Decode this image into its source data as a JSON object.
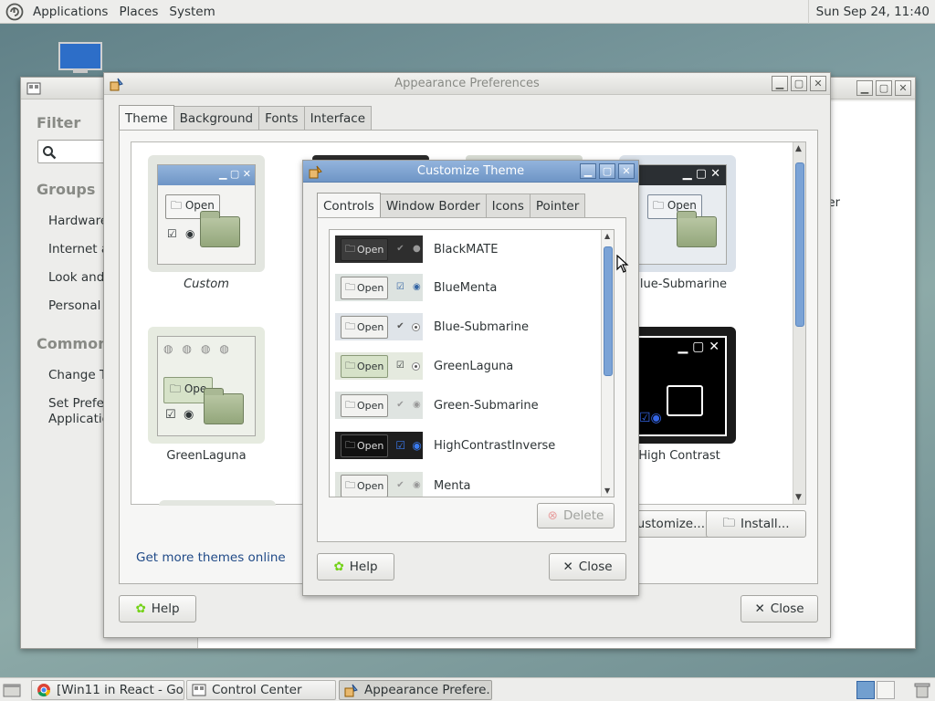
{
  "top_panel": {
    "menus": [
      "Applications",
      "Places",
      "System"
    ],
    "clock": "Sun Sep 24, 11:40"
  },
  "control_center": {
    "filter_label": "Filter",
    "groups_label": "Groups",
    "groups": [
      "Hardware",
      "Internet ar",
      "Look and F",
      "Personal"
    ],
    "common_label": "Common T",
    "common_tasks": [
      "Change Th",
      "Set Prefere",
      "Applicatio"
    ],
    "right_text": "er"
  },
  "appearance": {
    "title": "Appearance Preferences",
    "tabs": [
      "Theme",
      "Background",
      "Fonts",
      "Interface"
    ],
    "themes": {
      "custom": "Custom",
      "green_laguna": "GreenLaguna",
      "blue_submarine": "Blue-Submarine",
      "high_contrast": "High Contrast"
    },
    "preview_open": "Open",
    "preview_open_short": "Ope",
    "get_more": "Get more themes online",
    "customize_btn": "Customize...",
    "install_btn": "Install...",
    "help_btn": "Help",
    "close_btn": "Close"
  },
  "customize": {
    "title": "Customize Theme",
    "tabs": [
      "Controls",
      "Window Border",
      "Icons",
      "Pointer"
    ],
    "preview_open": "Open",
    "themes": [
      "BlackMATE",
      "BlueMenta",
      "Blue-Submarine",
      "GreenLaguna",
      "Green-Submarine",
      "HighContrastInverse",
      "Menta"
    ],
    "delete_btn": "Delete",
    "help_btn": "Help",
    "close_btn": "Close"
  },
  "taskbar": {
    "tasks": [
      "[Win11 in React - Go...",
      "Control Center",
      "Appearance Prefere..."
    ]
  },
  "colors": {
    "accent": "#6e95c6",
    "link": "#204a87",
    "scroll": "#7ba3d6"
  }
}
